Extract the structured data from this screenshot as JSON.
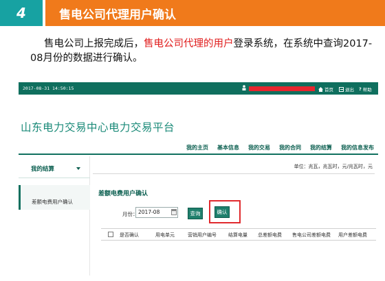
{
  "slide": {
    "step_number": "4",
    "title": "售电公司代理用户确认",
    "description_part1": "售电公司上报完成后，",
    "description_highlight": "售电公司代理的用户",
    "description_part2": "登录系统，在系统中查询2017-08月份的数据进行确认。"
  },
  "topbar": {
    "datetime": "2017-08-31 14:50:15",
    "links": [
      "首页",
      "退出",
      "帮助"
    ]
  },
  "platform_title": "山东电力交易中心电力交易平台",
  "nav": {
    "items": [
      "我的主页",
      "基本信息",
      "我的交易",
      "我的合同",
      "我的结算",
      "我的信息发布"
    ]
  },
  "sidebar": {
    "heading": "我的结算",
    "items": [
      "差额电费用户确认"
    ]
  },
  "unit_text": "单位：兆瓦，兆瓦时，元/兆瓦时，元",
  "section_title": "差额电费用户确认",
  "filter": {
    "month_label": "月份：",
    "month_value": "2017-08",
    "query_label": "查询",
    "confirm_label": "确认"
  },
  "table": {
    "columns": [
      "是否确认",
      "用电单元",
      "营销用户编号",
      "结算电量",
      "总差额电费",
      "售电公司差额电费",
      "用户差额电费"
    ]
  },
  "colors": {
    "step_box": "#17a2a2",
    "title_bar": "#f07a1b",
    "top_bar": "#0f6f5e",
    "highlight_red": "#e0282c",
    "text_highlight": "#e01b1b"
  }
}
